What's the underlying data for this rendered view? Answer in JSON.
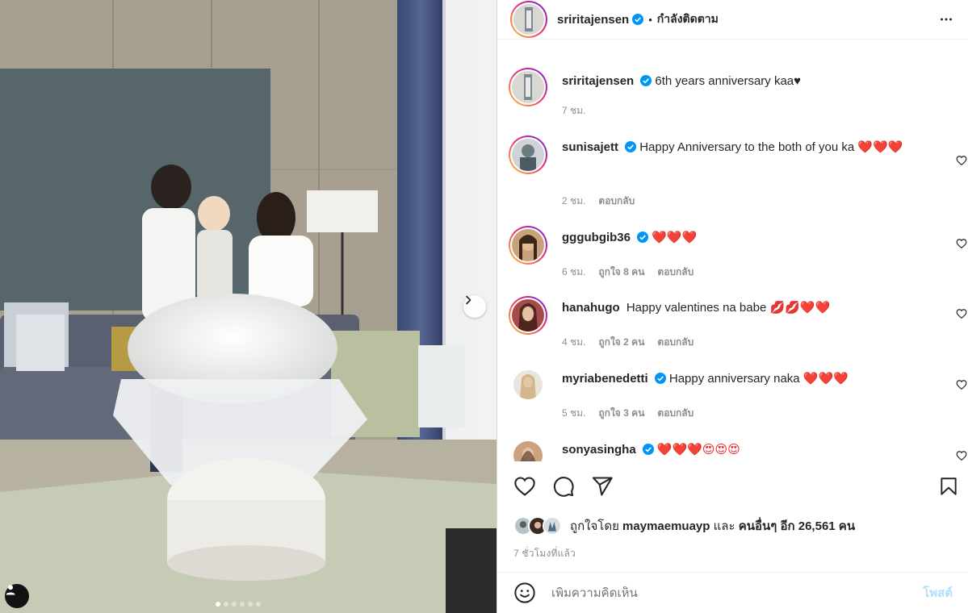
{
  "post": {
    "author": "sriritajensen",
    "follow_status": "กำลังติดตาม",
    "separator": "•",
    "caption": "6th years anniversary kaa♥",
    "caption_time": "7 ชม."
  },
  "comments": [
    {
      "user": "sunisajett",
      "verified": true,
      "text": "Happy Anniversary to the both of you ka",
      "emoji": "❤️❤️❤️",
      "time": "2 ชม.",
      "likes": "",
      "reply": "ตอบกลับ"
    },
    {
      "user": "gggubgib36",
      "verified": true,
      "text": "",
      "emoji": "❤️❤️❤️",
      "time": "6 ชม.",
      "likes": "ถูกใจ 8 คน",
      "reply": "ตอบกลับ"
    },
    {
      "user": "hanahugo",
      "verified": false,
      "text": "Happy valentines na babe",
      "emoji": "💋💋❤️❤️",
      "time": "4 ชม.",
      "likes": "ถูกใจ 2 คน",
      "reply": "ตอบกลับ"
    },
    {
      "user": "myriabenedetti",
      "verified": true,
      "text": "Happy anniversary naka",
      "emoji": "❤️❤️❤️",
      "time": "5 ชม.",
      "likes": "ถูกใจ 3 คน",
      "reply": "ตอบกลับ"
    },
    {
      "user": "sonyasingha",
      "verified": true,
      "text": "",
      "emoji": "❤️❤️❤️😍😍😍",
      "time": "",
      "likes": "",
      "reply": ""
    }
  ],
  "likes_line": {
    "prefix": "ถูกใจโดย",
    "first_user": "maymaemuayp",
    "conjunction": "และ",
    "others": "คนอื่นๆ อีก 26,561 คน"
  },
  "posted_time": "7 ชั่วโมงที่แล้ว",
  "composer": {
    "placeholder": "เพิ่มความคิดเห็น",
    "post_label": "โพสต์"
  },
  "carousel": {
    "current_slide": 1,
    "total_slides": 6
  },
  "icons": {
    "verified": "verified-badge-icon",
    "more": "more-options-icon",
    "like": "heart-outline-icon",
    "comment": "comment-bubble-icon",
    "share": "paper-plane-icon",
    "save": "bookmark-icon",
    "emoji": "smiley-icon",
    "next": "chevron-right-icon",
    "tags": "user-tag-icon"
  },
  "colors": {
    "verified": "#0095f6",
    "link_disabled": "#b2dffc",
    "heart": "#ed1c24",
    "muted": "#8e8e8e"
  }
}
